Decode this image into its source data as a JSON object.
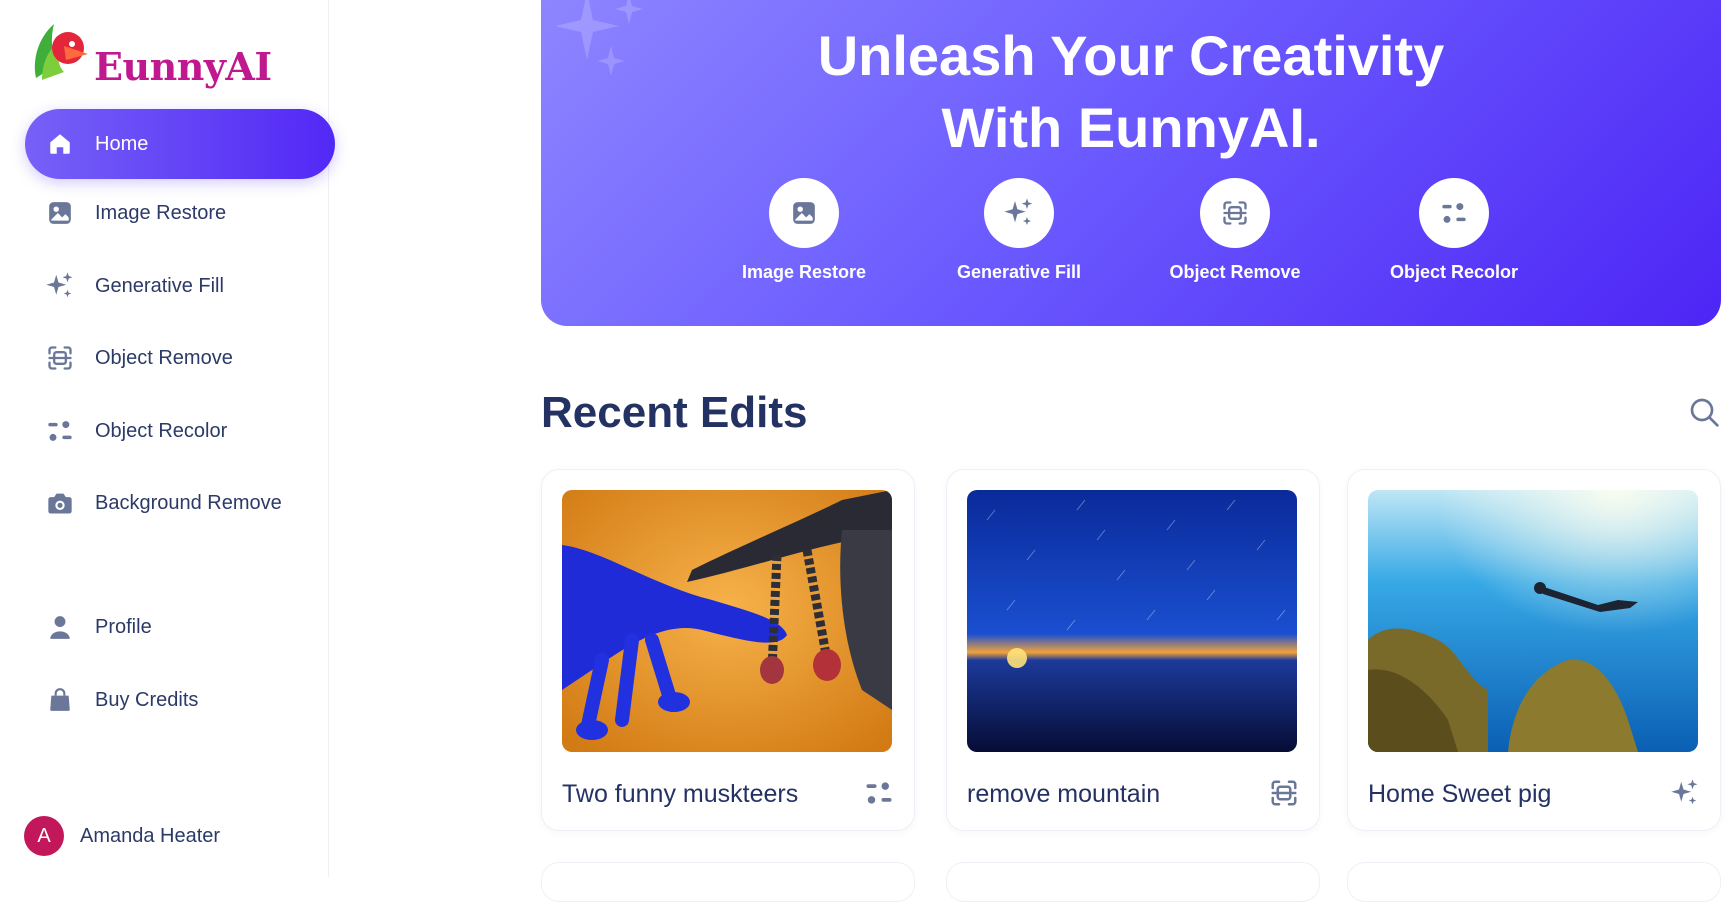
{
  "brand": {
    "name": "EunnyAI"
  },
  "sidebar": {
    "items": [
      {
        "label": "Home",
        "icon": "home-icon",
        "active": true
      },
      {
        "label": "Image Restore",
        "icon": "image-icon"
      },
      {
        "label": "Generative Fill",
        "icon": "sparkles-icon"
      },
      {
        "label": "Object Remove",
        "icon": "scan-icon"
      },
      {
        "label": "Object Recolor",
        "icon": "recolor-icon"
      },
      {
        "label": "Background Remove",
        "icon": "camera-icon"
      }
    ],
    "bottom_items": [
      {
        "label": "Profile",
        "icon": "user-icon"
      },
      {
        "label": "Buy Credits",
        "icon": "bag-icon"
      }
    ],
    "user": {
      "initial": "A",
      "name": "Amanda Heater"
    }
  },
  "hero": {
    "title_line1": "Unleash Your Creativity",
    "title_line2": "With EunnyAI.",
    "features": [
      {
        "label": "Image Restore",
        "icon": "image-icon"
      },
      {
        "label": "Generative Fill",
        "icon": "sparkles-icon"
      },
      {
        "label": "Object Remove",
        "icon": "scan-icon"
      },
      {
        "label": "Object Recolor",
        "icon": "recolor-icon"
      }
    ]
  },
  "recent": {
    "title": "Recent Edits",
    "cards": [
      {
        "title": "Two funny muskteers",
        "tool_icon": "recolor-icon"
      },
      {
        "title": "remove mountain",
        "tool_icon": "scan-icon"
      },
      {
        "title": "Home Sweet pig",
        "tool_icon": "sparkles-icon"
      }
    ]
  },
  "colors": {
    "accent": "#5228f6",
    "text": "#2b3a67",
    "avatar": "#c2185b",
    "icon": "#6b7799"
  }
}
